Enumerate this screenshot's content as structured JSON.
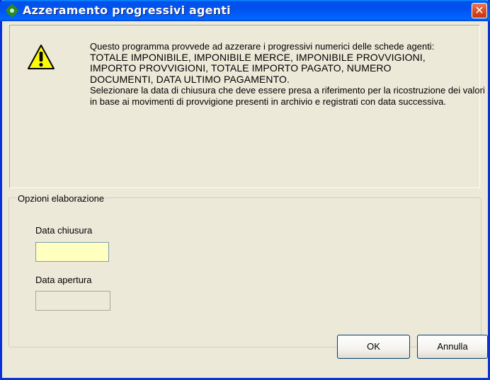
{
  "window": {
    "title": "Azzeramento progressivi agenti",
    "close_label": "✕"
  },
  "info": {
    "line1": "Questo programma provvede ad azzerare i progressivi numerici delle schede agenti:",
    "line2": "TOTALE IMPONIBILE, IMPONIBILE MERCE, IMPONIBILE PROVVIGIONI,",
    "line3": "IMPORTO PROVVIGIONI, TOTALE IMPORTO PAGATO, NUMERO",
    "line4": "DOCUMENTI, DATA ULTIMO PAGAMENTO.",
    "line5": "Selezionare la data di chiusura che deve essere presa a riferimento per la ricostruzione dei valori in base ai movimenti di provvigione presenti in archivio e registrati con data successiva."
  },
  "options": {
    "group_label": "Opzioni elaborazione",
    "closing_date_label": "Data chiusura",
    "closing_date_value": "",
    "opening_date_label": "Data apertura",
    "opening_date_value": ""
  },
  "buttons": {
    "ok_label": "OK",
    "cancel_label": "Annulla"
  },
  "colors": {
    "titlebar": "#0054e3",
    "dialog_bg": "#ece9d8",
    "active_field": "#ffffc0",
    "warning_icon": "#ffff00"
  }
}
